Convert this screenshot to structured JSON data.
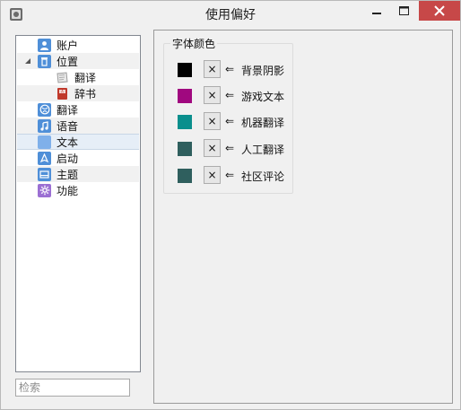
{
  "window": {
    "title": "使用偏好"
  },
  "sidebar": {
    "items": [
      {
        "label": "账户",
        "icon": "user-icon",
        "color": "#4f8fd8"
      },
      {
        "label": "位置",
        "icon": "trash-icon",
        "color": "#4f8fd8"
      },
      {
        "label": "翻译",
        "icon": "scroll-icon",
        "color": "#c9c9c9"
      },
      {
        "label": "辞书",
        "icon": "book-icon",
        "color": "#c0392b"
      },
      {
        "label": "翻译",
        "icon": "globe-icon",
        "color": "#4f8fd8"
      },
      {
        "label": "语音",
        "icon": "music-note-icon",
        "color": "#4f8fd8"
      },
      {
        "label": "文本",
        "icon": "text-icon",
        "color": "#7fb0ea"
      },
      {
        "label": "启动",
        "icon": "rocket-icon",
        "color": "#4f8fd8"
      },
      {
        "label": "主题",
        "icon": "theme-icon",
        "color": "#4f8fd8"
      },
      {
        "label": "功能",
        "icon": "gear-icon",
        "color": "#9b6fd3"
      }
    ]
  },
  "search": {
    "placeholder": "检索"
  },
  "font_color": {
    "title": "字体颜色",
    "arrow": "⇐",
    "clear_symbol": "×",
    "rows": [
      {
        "label": "背景阴影",
        "color": "#000000"
      },
      {
        "label": "游戏文本",
        "color": "#a0087f"
      },
      {
        "label": "机器翻译",
        "color": "#0a8f8d"
      },
      {
        "label": "人工翻译",
        "color": "#2f5f5e"
      },
      {
        "label": "社区评论",
        "color": "#2f5f5e"
      }
    ]
  }
}
